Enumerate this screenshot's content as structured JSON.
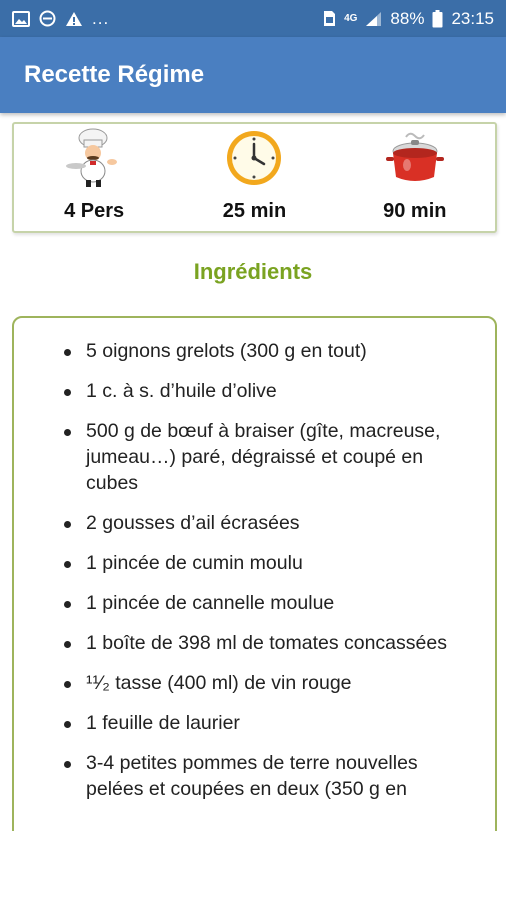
{
  "status_bar": {
    "icons_left": [
      "image-icon",
      "do-not-disturb-icon",
      "warning-icon"
    ],
    "overflow": "...",
    "network": "4G",
    "battery": "88%",
    "time": "23:15"
  },
  "app_bar": {
    "title": "Recette Régime"
  },
  "info": {
    "servings": "4 Pers",
    "prep_time": "25 min",
    "cook_time": "90 min",
    "icons": [
      "chef-icon",
      "clock-icon",
      "cooking-pot-icon"
    ]
  },
  "ingredients": {
    "title": "Ingrédients",
    "items": [
      "5 oignons grelots (300 g en tout)",
      "1 c. à s. d’huile d’olive",
      "500 g de bœuf à braiser (gîte, macreuse, jumeau…) paré, dégraissé et coupé en cubes",
      "2 gousses d’ail écrasées",
      "1 pincée de cumin moulu",
      "1 pincée de cannelle moulue",
      "1 boîte de 398 ml de tomates concassées",
      "¹¹⁄₂ tasse (400 ml) de vin rouge",
      "1 feuille de laurier",
      "3-4 petites pommes de terre nouvelles pelées et coupées en deux (350 g en"
    ]
  },
  "colors": {
    "status_bar": "#3b6ea8",
    "app_bar": "#4a7fc1",
    "accent_green": "#7aa321",
    "card_border": "#9eb45c"
  }
}
